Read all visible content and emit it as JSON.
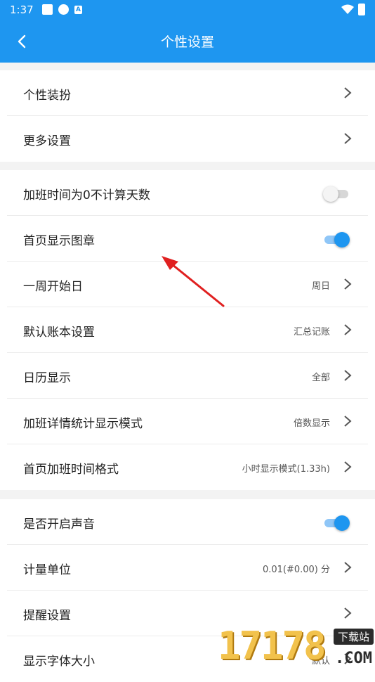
{
  "status": {
    "time": "1:37"
  },
  "header": {
    "title": "个性设置"
  },
  "groups": [
    {
      "rows": [
        {
          "label": "个性装扮"
        },
        {
          "label": "更多设置"
        }
      ]
    },
    {
      "rows": [
        {
          "label": "加班时间为0不计算天数",
          "toggle": false
        },
        {
          "label": "首页显示图章",
          "toggle": true
        },
        {
          "label": "一周开始日",
          "value": "周日"
        },
        {
          "label": "默认账本设置",
          "value": "汇总记账"
        },
        {
          "label": "日历显示",
          "value": "全部"
        },
        {
          "label": "加班详情统计显示模式",
          "value": "倍数显示"
        },
        {
          "label": "首页加班时间格式",
          "value": "小时显示模式(1.33h)"
        }
      ]
    },
    {
      "rows": [
        {
          "label": "是否开启声音",
          "toggle": true
        },
        {
          "label": "计量单位",
          "value": "0.01(#0.00) 分"
        },
        {
          "label": "提醒设置"
        },
        {
          "label": "显示字体大小",
          "value": "默认"
        }
      ]
    }
  ],
  "watermark": {
    "digits": "17178",
    "top": "下载站",
    "com": ".COM"
  },
  "colors": {
    "primary": "#1e96f0",
    "annotation_arrow": "#e02020"
  }
}
